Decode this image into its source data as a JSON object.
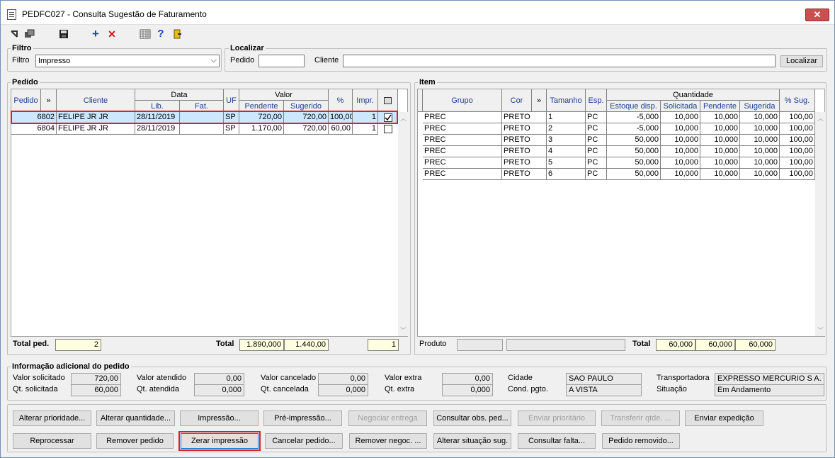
{
  "window": {
    "title": "PEDFC027 - Consulta Sugestão de Faturamento",
    "close": "✕"
  },
  "toolbar": {
    "icons": [
      "arrow-icon",
      "duplicate-icon",
      "save-icon",
      "add-icon",
      "delete-icon",
      "calendar-grid-icon",
      "help-icon",
      "exit-icon"
    ],
    "add": "+",
    "delete": "✕",
    "help": "?"
  },
  "filtro": {
    "group_label": "Filtro",
    "label": "Filtro",
    "value": "Impresso"
  },
  "localizar": {
    "group_label": "Localizar",
    "pedido_label": "Pedido",
    "pedido_value": "",
    "cliente_label": "Cliente",
    "cliente_value": "",
    "button": "Localizar"
  },
  "pedido": {
    "group_label": "Pedido",
    "headers": {
      "pedido": "Pedido",
      "more": "»",
      "cliente": "Cliente",
      "data": "Data",
      "lib": "Lib.",
      "fat": "Fat.",
      "uf": "UF",
      "valor": "Valor",
      "pendente": "Pendente",
      "sugerido": "Sugerido",
      "pct": "%",
      "impr": "Impr."
    },
    "rows": [
      {
        "pedido": "6802",
        "cliente": "FELIPE JR JR",
        "lib": "28/11/2019",
        "fat": "",
        "uf": "SP",
        "pendente": "720,00",
        "sugerido": "720,00",
        "pct": "100,00",
        "impr": "1",
        "checked": true
      },
      {
        "pedido": "6804",
        "cliente": "FELIPE JR JR",
        "lib": "28/11/2019",
        "fat": "",
        "uf": "SP",
        "pendente": "1.170,00",
        "sugerido": "720,00",
        "pct": "60,00",
        "impr": "1",
        "checked": false
      }
    ],
    "total_ped_label": "Total ped.",
    "total_ped": "2",
    "total_label": "Total",
    "total_pendente": "1.890,000",
    "total_sugerido": "1.440,00",
    "total_impr": "1"
  },
  "item": {
    "group_label": "Item",
    "headers": {
      "grupo": "Grupo",
      "cor": "Cor",
      "more": "»",
      "tamanho": "Tamanho",
      "esp": "Esp.",
      "quantidade": "Quantidade",
      "estoque": "Estoque disp.",
      "solicitada": "Solicitada",
      "pendente": "Pendente",
      "sugerida": "Sugerida",
      "pct_sug": "% Sug."
    },
    "rows": [
      {
        "grupo": "PREC",
        "cor": "PRETO",
        "tamanho": "1",
        "esp": "PC",
        "estoque": "-5,000",
        "solicitada": "10,000",
        "pendente": "10,000",
        "sugerida": "10,000",
        "pct": "100,00"
      },
      {
        "grupo": "PREC",
        "cor": "PRETO",
        "tamanho": "2",
        "esp": "PC",
        "estoque": "-5,000",
        "solicitada": "10,000",
        "pendente": "10,000",
        "sugerida": "10,000",
        "pct": "100,00"
      },
      {
        "grupo": "PREC",
        "cor": "PRETO",
        "tamanho": "3",
        "esp": "PC",
        "estoque": "50,000",
        "solicitada": "10,000",
        "pendente": "10,000",
        "sugerida": "10,000",
        "pct": "100,00"
      },
      {
        "grupo": "PREC",
        "cor": "PRETO",
        "tamanho": "4",
        "esp": "PC",
        "estoque": "50,000",
        "solicitada": "10,000",
        "pendente": "10,000",
        "sugerida": "10,000",
        "pct": "100,00"
      },
      {
        "grupo": "PREC",
        "cor": "PRETO",
        "tamanho": "5",
        "esp": "PC",
        "estoque": "50,000",
        "solicitada": "10,000",
        "pendente": "10,000",
        "sugerida": "10,000",
        "pct": "100,00"
      },
      {
        "grupo": "PREC",
        "cor": "PRETO",
        "tamanho": "6",
        "esp": "PC",
        "estoque": "50,000",
        "solicitada": "10,000",
        "pendente": "10,000",
        "sugerida": "10,000",
        "pct": "100,00"
      }
    ],
    "produto_label": "Produto",
    "total_label": "Total",
    "total_solicitada": "60,000",
    "total_pendente": "60,000",
    "total_sugerida": "60,000"
  },
  "info": {
    "group_label": "Informação adicional do pedido",
    "valor_solicitado_label": "Valor solicitado",
    "valor_solicitado": "720,00",
    "qt_solicitada_label": "Qt. solicitada",
    "qt_solicitada": "60,000",
    "valor_atendido_label": "Valor atendido",
    "valor_atendido": "0,00",
    "qt_atendida_label": "Qt. atendida",
    "qt_atendida": "0,000",
    "valor_cancelado_label": "Valor cancelado",
    "valor_cancelado": "0,00",
    "qt_cancelada_label": "Qt. cancelada",
    "qt_cancelada": "0,000",
    "valor_extra_label": "Valor extra",
    "valor_extra": "0,00",
    "qt_extra_label": "Qt. extra",
    "qt_extra": "0,000",
    "cidade_label": "Cidade",
    "cidade": "SAO PAULO",
    "cond_pgto_label": "Cond. pgto.",
    "cond_pgto": "A VISTA",
    "transportadora_label": "Transportadora",
    "transportadora": "EXPRESSO MERCURIO S A.",
    "situacao_label": "Situação",
    "situacao": "Em Andamento"
  },
  "buttons": {
    "alterar_prioridade": "Alterar prioridade...",
    "alterar_quantidade": "Alterar quantidade...",
    "impressao": "Impressão...",
    "pre_impressao": "Pré-impressão...",
    "negociar_entrega": "Negociar entrega",
    "consultar_obs": "Consultar obs. ped...",
    "enviar_prioritario": "Enviar prioritário",
    "transferir_qtde": "Transferir qtde. ...",
    "enviar_expedicao": "Enviar expedição",
    "reprocessar": "Reprocessar",
    "remover_pedido": "Remover pedido",
    "zerar_impressao": "Zerar impressão",
    "cancelar_pedido": "Cancelar pedido...",
    "remover_negoc": "Remover negoc. ...",
    "alterar_situacao": "Alterar situação sug.",
    "consultar_falta": "Consultar falta...",
    "pedido_removido": "Pedido removido..."
  },
  "colors": {
    "highlight": "#e02020",
    "selected_row": "#cce8ff",
    "header_text": "#1c3d8f",
    "total_bg": "#ffffe1"
  }
}
